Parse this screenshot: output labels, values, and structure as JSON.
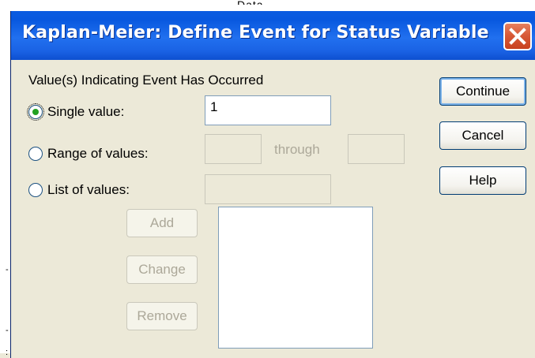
{
  "dialog": {
    "title": "Kaplan-Meier: Define Event for Status Variable",
    "group_label": "Value(s) Indicating Event Has Occurred",
    "options": {
      "single": {
        "label": "Single value:",
        "selected": true,
        "value": "1"
      },
      "range": {
        "label": "Range of values:",
        "selected": false,
        "from": "",
        "through_label": "through",
        "to": ""
      },
      "list": {
        "label": "List of values:",
        "selected": false,
        "value": ""
      }
    },
    "list_buttons": {
      "add": "Add",
      "change": "Change",
      "remove": "Remove"
    },
    "buttons": {
      "continue": "Continue",
      "cancel": "Cancel",
      "help": "Help"
    }
  },
  "colors": {
    "titlebar": "#0a5be0",
    "dialog_bg": "#ece9d8",
    "close_button": "#d85a38",
    "radio_dot": "#21a121"
  }
}
